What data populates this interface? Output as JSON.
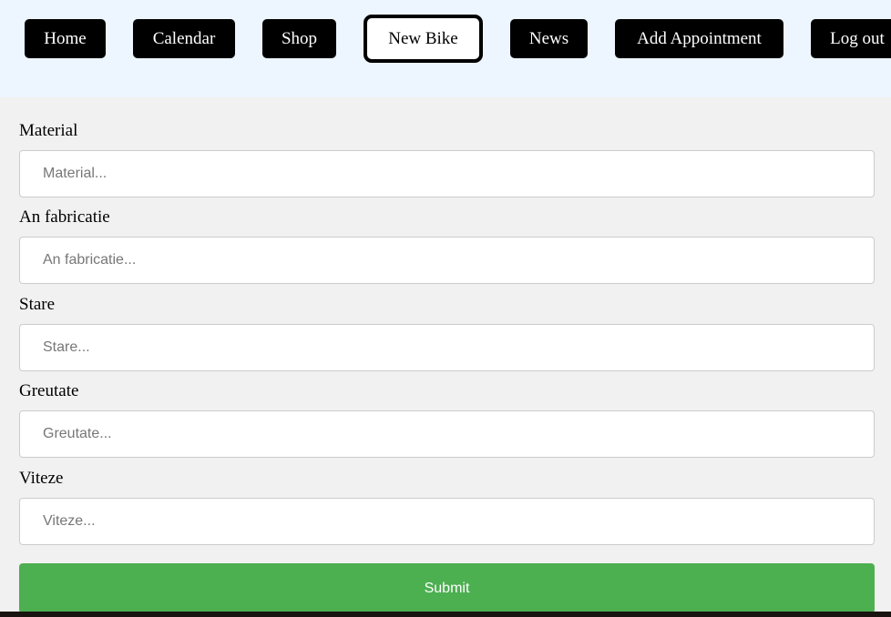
{
  "nav": {
    "items": [
      {
        "label": "Home"
      },
      {
        "label": "Calendar"
      },
      {
        "label": "Shop"
      },
      {
        "label": "New Bike"
      },
      {
        "label": "News"
      },
      {
        "label": "Add Appointment"
      },
      {
        "label": "Log out"
      }
    ],
    "active": "New Bike"
  },
  "form": {
    "fields": [
      {
        "label": "Material",
        "placeholder": "Material..."
      },
      {
        "label": "An fabricatie",
        "placeholder": "An fabricatie..."
      },
      {
        "label": "Stare",
        "placeholder": "Stare..."
      },
      {
        "label": "Greutate",
        "placeholder": "Greutate..."
      },
      {
        "label": "Viteze",
        "placeholder": "Viteze..."
      }
    ],
    "submit_label": "Submit"
  },
  "colors": {
    "header_background": "#edf6ff",
    "page_background": "#f1f1f1",
    "nav_button": "#000000",
    "submit_button": "#4caf50"
  }
}
